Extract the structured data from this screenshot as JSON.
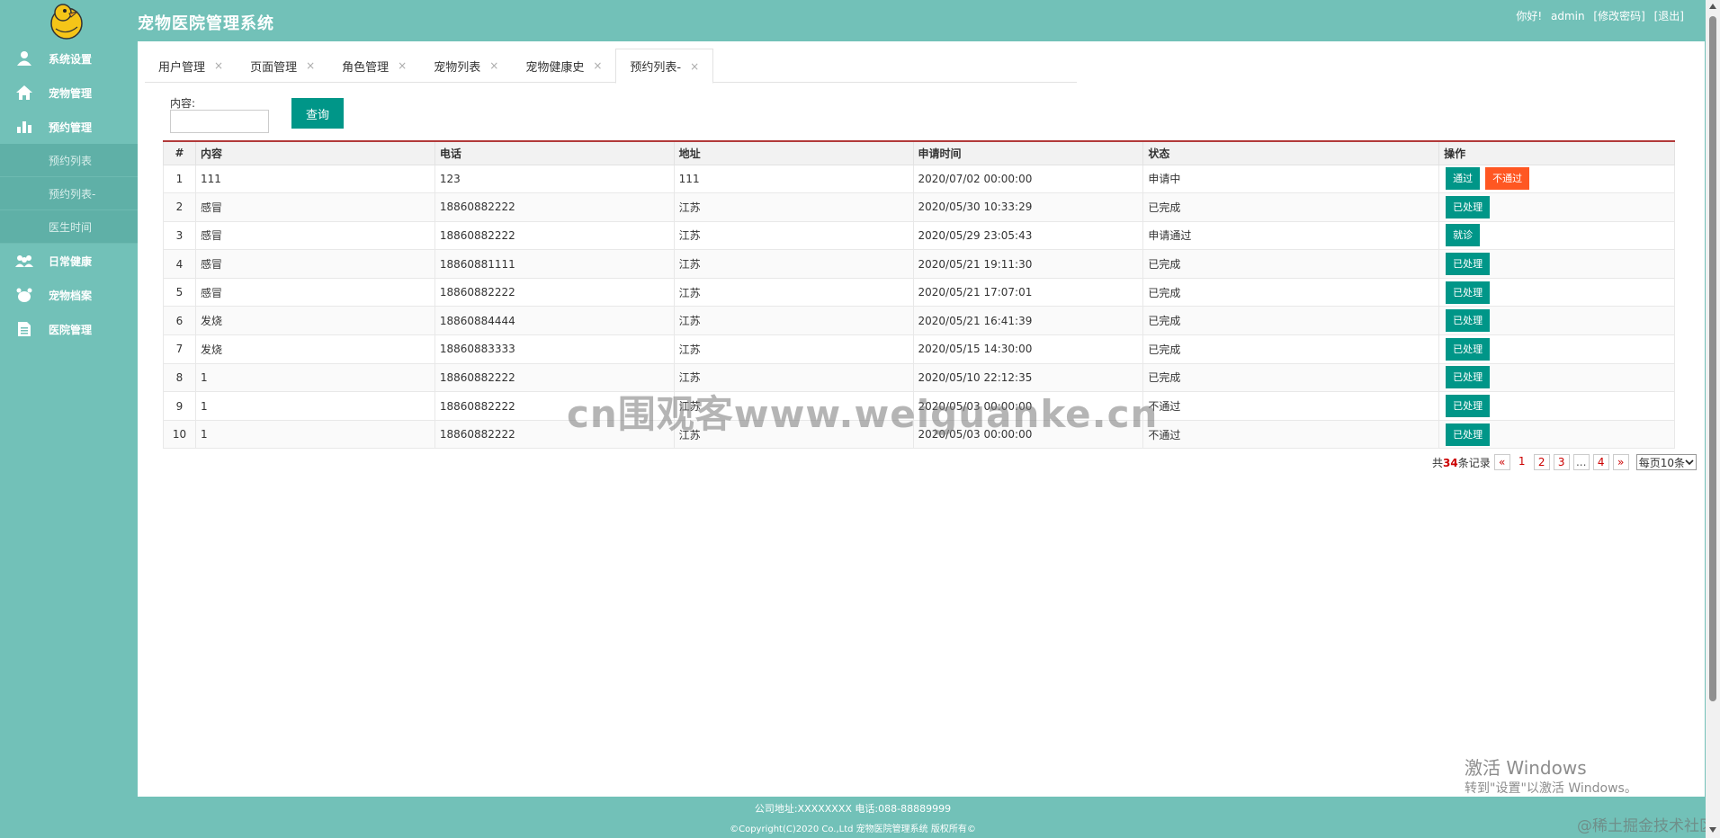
{
  "header": {
    "title": "宠物医院管理系统",
    "greeting": "你好!",
    "username": "admin",
    "change_password": "[修改密码]",
    "logout": "[退出]"
  },
  "sidebar": {
    "items": [
      {
        "label": "系统设置",
        "icon": "user-icon"
      },
      {
        "label": "宠物管理",
        "icon": "home-icon"
      },
      {
        "label": "预约管理",
        "icon": "bar-chart-icon"
      }
    ],
    "subitems": [
      {
        "label": "预约列表"
      },
      {
        "label": "预约列表-"
      },
      {
        "label": "医生时间"
      }
    ],
    "items2": [
      {
        "label": "日常健康",
        "icon": "group-icon"
      },
      {
        "label": "宠物档案",
        "icon": "pet-icon"
      },
      {
        "label": "医院管理",
        "icon": "document-icon"
      }
    ]
  },
  "tabs": [
    {
      "label": "用户管理"
    },
    {
      "label": "页面管理"
    },
    {
      "label": "角色管理"
    },
    {
      "label": "宠物列表"
    },
    {
      "label": "宠物健康史"
    },
    {
      "label": "预约列表-"
    }
  ],
  "tab_close": "×",
  "search": {
    "label": "内容:",
    "value": "",
    "button": "查询"
  },
  "table": {
    "headers": [
      "#",
      "内容",
      "电话",
      "地址",
      "申请时间",
      "状态",
      "操作"
    ],
    "rows": [
      {
        "no": "1",
        "content": "111",
        "phone": "123",
        "addr": "111",
        "time": "2020/07/02 00:00:00",
        "status": "申请中",
        "actions": [
          "通过",
          "不通过"
        ]
      },
      {
        "no": "2",
        "content": "感冒",
        "phone": "18860882222",
        "addr": "江苏",
        "time": "2020/05/30 10:33:29",
        "status": "已完成",
        "actions": [
          "已处理"
        ]
      },
      {
        "no": "3",
        "content": "感冒",
        "phone": "18860882222",
        "addr": "江苏",
        "time": "2020/05/29 23:05:43",
        "status": "申请通过",
        "actions": [
          "就诊"
        ]
      },
      {
        "no": "4",
        "content": "感冒",
        "phone": "18860881111",
        "addr": "江苏",
        "time": "2020/05/21 19:11:30",
        "status": "已完成",
        "actions": [
          "已处理"
        ]
      },
      {
        "no": "5",
        "content": "感冒",
        "phone": "18860882222",
        "addr": "江苏",
        "time": "2020/05/21 17:07:01",
        "status": "已完成",
        "actions": [
          "已处理"
        ]
      },
      {
        "no": "6",
        "content": "发烧",
        "phone": "18860884444",
        "addr": "江苏",
        "time": "2020/05/21 16:41:39",
        "status": "已完成",
        "actions": [
          "已处理"
        ]
      },
      {
        "no": "7",
        "content": "发烧",
        "phone": "18860883333",
        "addr": "江苏",
        "time": "2020/05/15 14:30:00",
        "status": "已完成",
        "actions": [
          "已处理"
        ]
      },
      {
        "no": "8",
        "content": "1",
        "phone": "18860882222",
        "addr": "江苏",
        "time": "2020/05/10 22:12:35",
        "status": "已完成",
        "actions": [
          "已处理"
        ]
      },
      {
        "no": "9",
        "content": "1",
        "phone": "18860882222",
        "addr": "江苏",
        "time": "2020/05/03 00:00:00",
        "status": "不通过",
        "actions": [
          "已处理"
        ]
      },
      {
        "no": "10",
        "content": "1",
        "phone": "18860882222",
        "addr": "江苏",
        "time": "2020/05/03 00:00:00",
        "status": "不通过",
        "actions": [
          "已处理"
        ]
      }
    ]
  },
  "pager": {
    "total_prefix": "共",
    "total": "34",
    "total_suffix": "条记录",
    "prev": "«",
    "pages": [
      "1",
      "2",
      "3",
      "...",
      "4"
    ],
    "next": "»",
    "page_size": "每页10条"
  },
  "watermark": "cn围观客www.weiguanke.cn",
  "windows_activation": {
    "line1": "激活 Windows",
    "line2": "转到\"设置\"以激活 Windows。"
  },
  "footer": {
    "address": "公司地址:XXXXXXXX 电话:088-88889999",
    "copyright": "©Copyright(C)2020 Co.,Ltd 宠物医院管理系统 版权所有©"
  },
  "juejin": "@稀土掘金技术社区",
  "colors": {
    "theme": "#72c1b8",
    "primary_button": "#009688",
    "danger_button": "#ff5722"
  }
}
